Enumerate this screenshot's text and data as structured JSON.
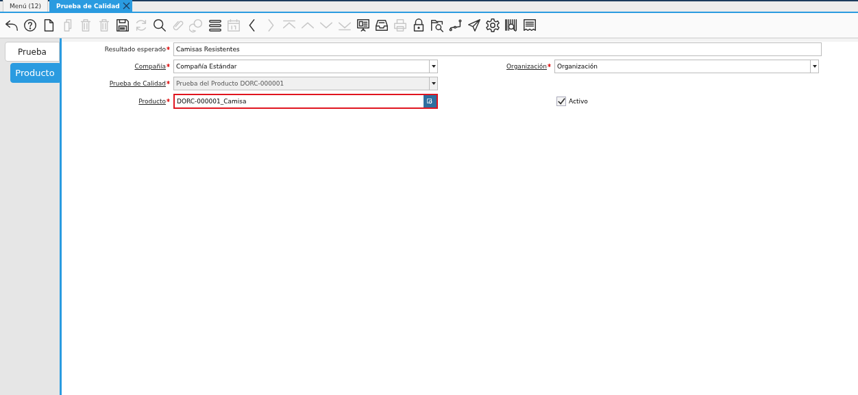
{
  "tabs": [
    {
      "label": "Menú (12)",
      "selected": false,
      "closable": false
    },
    {
      "label": "Prueba de Calidad",
      "selected": true,
      "closable": true
    }
  ],
  "toolbar": [
    {
      "kind": "undo",
      "disabled": false
    },
    {
      "kind": "help",
      "disabled": false
    },
    {
      "kind": "new",
      "disabled": false
    },
    {
      "kind": "copy",
      "disabled": true
    },
    {
      "kind": "delete",
      "disabled": true
    },
    {
      "kind": "delete",
      "disabled": true
    },
    {
      "kind": "save",
      "disabled": false
    },
    {
      "kind": "refresh",
      "disabled": true
    },
    {
      "kind": "search",
      "disabled": false
    },
    {
      "kind": "attachment",
      "disabled": true
    },
    {
      "kind": "chat",
      "disabled": true
    },
    {
      "kind": "menu",
      "disabled": false
    },
    {
      "kind": "calendar",
      "disabled": true
    },
    {
      "kind": "previous",
      "disabled": false
    },
    {
      "kind": "next",
      "disabled": true
    },
    {
      "kind": "first",
      "disabled": true
    },
    {
      "kind": "up",
      "disabled": true
    },
    {
      "kind": "down",
      "disabled": true
    },
    {
      "kind": "last",
      "disabled": true
    },
    {
      "kind": "report",
      "disabled": false
    },
    {
      "kind": "archive",
      "disabled": false
    },
    {
      "kind": "print",
      "disabled": true
    },
    {
      "kind": "lock",
      "disabled": false
    },
    {
      "kind": "zoom",
      "disabled": false
    },
    {
      "kind": "workflow",
      "disabled": false
    },
    {
      "kind": "send",
      "disabled": false
    },
    {
      "kind": "settings",
      "disabled": false
    },
    {
      "kind": "barcode",
      "disabled": false
    },
    {
      "kind": "receipt",
      "disabled": false
    }
  ],
  "side_tabs": [
    {
      "label": "Prueba",
      "selected": false
    },
    {
      "label": "Producto",
      "selected": true
    }
  ],
  "form": {
    "rows": [
      {
        "fields": [
          {
            "kind": "text",
            "label": "Resultado esperado",
            "required": true,
            "link": false,
            "value": "Camisas Resistentes",
            "wide": true,
            "disabled": false,
            "error": false
          }
        ]
      },
      {
        "fields": [
          {
            "kind": "select",
            "label": "Compañía",
            "required": true,
            "link": true,
            "value": "Compañía Estándar",
            "wide": false,
            "disabled": false,
            "error": false
          },
          {
            "kind": "select",
            "label": "Organización",
            "required": true,
            "link": true,
            "value": "Organización",
            "wide": false,
            "disabled": false,
            "error": false
          }
        ]
      },
      {
        "fields": [
          {
            "kind": "select",
            "label": "Prueba de Calidad",
            "required": true,
            "link": true,
            "value": "Prueba del Producto DORC-000001",
            "wide": false,
            "disabled": true,
            "error": false
          }
        ]
      },
      {
        "fields": [
          {
            "kind": "search",
            "label": "Producto",
            "required": true,
            "link": true,
            "value": "DORC-000001_Camisa",
            "wide": false,
            "disabled": false,
            "error": true
          },
          {
            "kind": "checkbox",
            "label": "Activo",
            "checked": true
          }
        ]
      }
    ]
  }
}
